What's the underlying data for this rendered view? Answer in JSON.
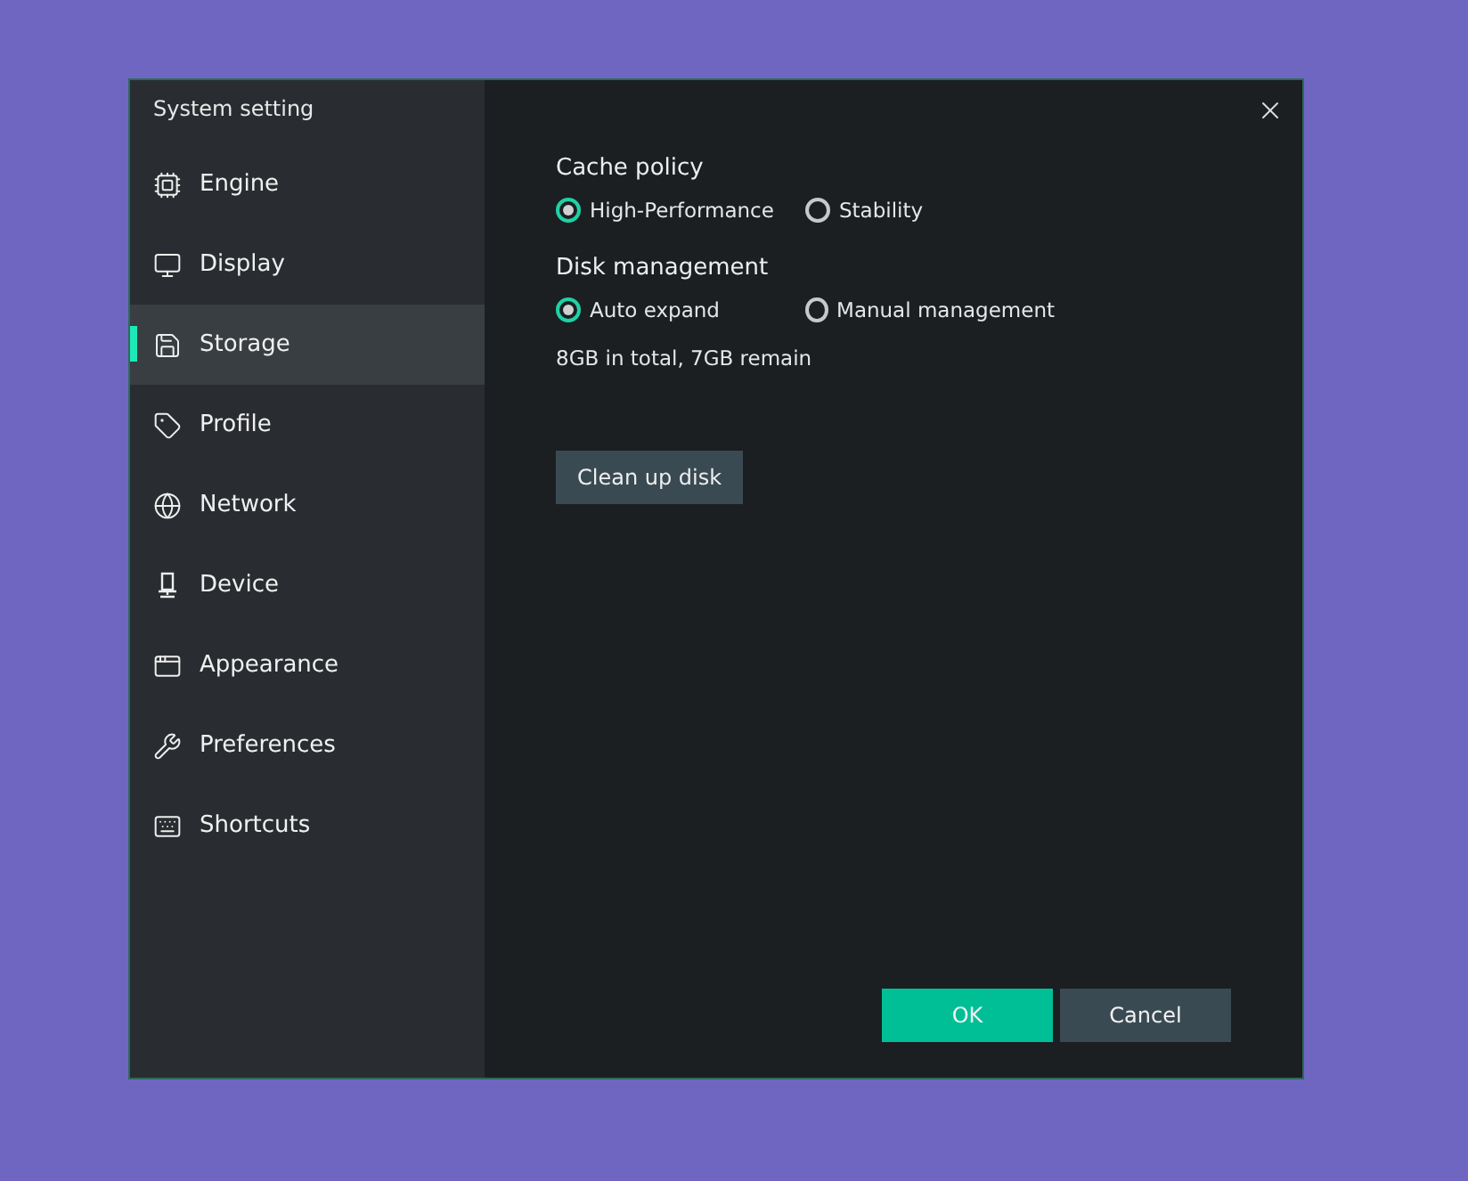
{
  "window": {
    "title": "System setting"
  },
  "sidebar": {
    "items": [
      {
        "label": "Engine",
        "selected": false
      },
      {
        "label": "Display",
        "selected": false
      },
      {
        "label": "Storage",
        "selected": true
      },
      {
        "label": "Profile",
        "selected": false
      },
      {
        "label": "Network",
        "selected": false
      },
      {
        "label": "Device",
        "selected": false
      },
      {
        "label": "Appearance",
        "selected": false
      },
      {
        "label": "Preferences",
        "selected": false
      },
      {
        "label": "Shortcuts",
        "selected": false
      }
    ]
  },
  "sections": [
    {
      "title": "Cache policy",
      "options": [
        {
          "label": "High-Performance",
          "selected": true
        },
        {
          "label": "Stability",
          "selected": false
        }
      ]
    },
    {
      "title": "Disk management",
      "options": [
        {
          "label": "Auto expand",
          "selected": true
        },
        {
          "label": "Manual management",
          "selected": false
        }
      ],
      "note": "8GB in total, 7GB remain"
    }
  ],
  "action_button": "Clean up disk",
  "buttons": [
    {
      "label": "OK",
      "kind": "primary"
    },
    {
      "label": "Cancel",
      "kind": "secondary"
    }
  ]
}
